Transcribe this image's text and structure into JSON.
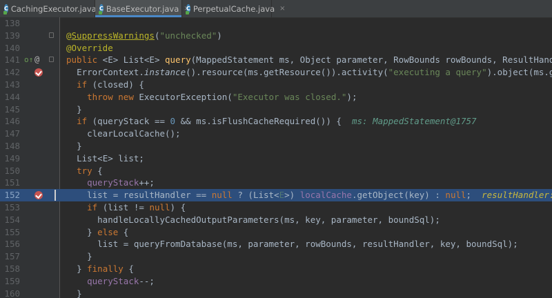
{
  "tabs": [
    {
      "label": "CachingExecutor.java",
      "icon": "java-class-icon",
      "close": "×"
    },
    {
      "label": "BaseExecutor.java",
      "icon": "java-class-icon",
      "close": "×",
      "active": true
    },
    {
      "label": "PerpetualCache.java",
      "icon": "java-class-icon",
      "close": "×"
    }
  ],
  "editor": {
    "current_line": "152",
    "lines": [
      {
        "n": "138"
      },
      {
        "n": "139"
      },
      {
        "n": "140"
      },
      {
        "n": "141"
      },
      {
        "n": "142"
      },
      {
        "n": "143"
      },
      {
        "n": "144"
      },
      {
        "n": "145"
      },
      {
        "n": "146"
      },
      {
        "n": "147"
      },
      {
        "n": "148"
      },
      {
        "n": "149"
      },
      {
        "n": "150"
      },
      {
        "n": "151"
      },
      {
        "n": "152"
      },
      {
        "n": "153"
      },
      {
        "n": "154"
      },
      {
        "n": "155"
      },
      {
        "n": "156"
      },
      {
        "n": "157"
      },
      {
        "n": "158"
      },
      {
        "n": "159"
      },
      {
        "n": "160"
      }
    ],
    "tok": {
      "l139": {
        "at": "@",
        "ann": "SuppressWarnings",
        "open": "(",
        "str": "\"unchecked\"",
        "close": ")"
      },
      "l140": {
        "ann": "@Override"
      },
      "l141": {
        "kw": "public",
        "sig": " <E> List<E> ",
        "fn": "query",
        "params": "(MappedStatement ms, Object parameter, RowBounds rowBounds, ResultHandler resultHandler, CacheKey key, BoundSql boundSql) {"
      },
      "l142": {
        "a": "ErrorContext.",
        "b": "instance",
        "c": "().resource(ms.getResource()).activity(",
        "d": "\"executing a query\"",
        "e": ").object(ms.getId());"
      },
      "l143": {
        "kw": "if",
        "rest": " (closed) {"
      },
      "l144": {
        "kw": "throw new",
        "a": " ExecutorException(",
        "str": "\"Executor was closed.\"",
        "b": ");"
      },
      "l145": {
        "a": "}"
      },
      "l146": {
        "kw": "if",
        "a": " (queryStack == ",
        "num": "0",
        "b": " && ms.isFlushCacheRequired()) {",
        "hint": "ms: MappedStatement@1757"
      },
      "l147": {
        "a": "clearLocalCache();"
      },
      "l148": {
        "a": "}"
      },
      "l149": {
        "a": "List<E> list;"
      },
      "l150": {
        "kw": "try",
        "a": " {"
      },
      "l151": {
        "field": "queryStack",
        "a": "++;"
      },
      "l152": {
        "a": "list = resultHandler == ",
        "nul1": "null",
        "b": " ? (List<",
        "g": "E",
        "c": ">) ",
        "field": "localCache",
        "d": ".getObject(key) : ",
        "nul2": "null",
        "e": ";",
        "hint": "resultHandler: null"
      },
      "l153": {
        "kw": "if",
        "a": " (list != ",
        "nul": "null",
        "b": ") {"
      },
      "l154": {
        "a": "handleLocallyCachedOutputParameters(ms, key, parameter, boundSql);"
      },
      "l155": {
        "a": "} ",
        "kw": "else",
        "b": " {"
      },
      "l156": {
        "a": "list = queryFromDatabase(ms, parameter, rowBounds, resultHandler, key, boundSql);"
      },
      "l157": {
        "a": "}"
      },
      "l158": {
        "a": "} ",
        "kw": "finally",
        "b": " {"
      },
      "l159": {
        "field": "queryStack",
        "a": "--;"
      },
      "l160": {
        "a": "}"
      }
    },
    "gutter_icons": {
      "l141_impl": "o↑",
      "l141_ann": "@"
    }
  },
  "colors": {
    "background": "#2b2b2b",
    "gutter": "#313335",
    "keyword": "#cc7832",
    "string": "#6a8759",
    "annotation": "#bbb529",
    "method": "#ffc66d",
    "field": "#9876aa",
    "number": "#6897bb",
    "breakpoint": "#c75450",
    "execution_line": "#2d4e7c"
  }
}
